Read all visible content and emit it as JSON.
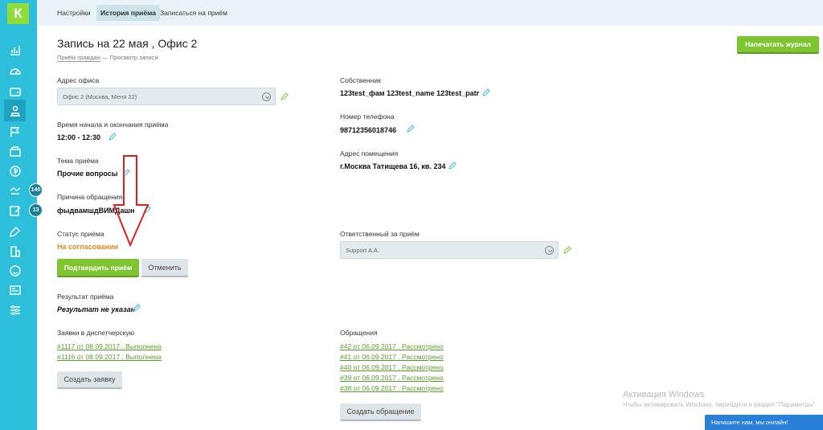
{
  "app": {
    "logo_letter": "К",
    "accent_color": "#2dbedc",
    "green_color": "#7ec531"
  },
  "topnav": {
    "tabs": [
      {
        "label": "Настройки"
      },
      {
        "label": "История приёма"
      },
      {
        "label": "Записаться на приём"
      }
    ]
  },
  "sidebar": {
    "icons": [
      "chart-icon",
      "dashboard-icon",
      "wallet-icon",
      "reception-icon",
      "flag-icon",
      "box-icon",
      "money-icon",
      "handshake-icon",
      "edit-icon",
      "tag-icon",
      "building-icon",
      "smile-icon",
      "newspaper-icon",
      "settings-icon"
    ],
    "badges": [
      {
        "value": "140"
      },
      {
        "value": "13"
      }
    ]
  },
  "page": {
    "title": "Запись на 22 мая , Офис 2",
    "breadcrumb_link": "Приём граждан",
    "breadcrumb_sep": "—",
    "breadcrumb_current": "Просмотр записи",
    "print_button": "Напечатать журнал"
  },
  "left": {
    "office_label": "Адрес офиса",
    "office_value": "Офис 2 (Москва, Меня 22)",
    "time_label": "Время начала и окончания приёма",
    "time_value": "12:00 - 12:30",
    "topic_label": "Тема приёма",
    "topic_value": "Прочие вопросы",
    "reason_label": "Причина обращения",
    "reason_value": "фыдвамшдВИМДашн",
    "status_label": "Статус приёма",
    "status_value": "На согласовании",
    "confirm_button": "Подтвердить приём",
    "cancel_button": "Отменить",
    "result_label": "Результат приёма",
    "result_value": "Результат не указан",
    "dispatch_label": "Заявки в диспетчерскую",
    "dispatch_links": [
      "#1117 от 08.09.2017 . Выполнена",
      "#1116 от 08.09.2017 . Выполнена"
    ],
    "create_request_button": "Создать заявку"
  },
  "right": {
    "owner_label": "Собственник",
    "owner_value": "123test_фам 123test_name 123test_patr",
    "phone_label": "Номер телефона",
    "phone_value": "98712356018746",
    "address_label": "Адрес помещения",
    "address_value": "г.Москва Татищева 16, кв. 234",
    "responsible_label": "Ответственный за приём",
    "responsible_value": "Support A.A.",
    "appeals_label": "Обращения",
    "appeals_links": [
      "#42 от 06.09.2017 . Рассмотрено",
      "#41 от 06.09.2017 . Рассмотрено",
      "#40 от 06.09.2017 . Рассмотрено",
      "#39 от 06.09.2017 . Рассмотрено",
      "#38 от 06.09.2017 . Рассмотрено"
    ],
    "create_appeal_button": "Создать обращение"
  },
  "overlay": {
    "watermark_title": "Активация Windows",
    "watermark_text": "Чтобы активировать Windows, перейдите в раздел \"Параметры\".",
    "chat_text": "Напишите нам, мы онлайн!"
  }
}
